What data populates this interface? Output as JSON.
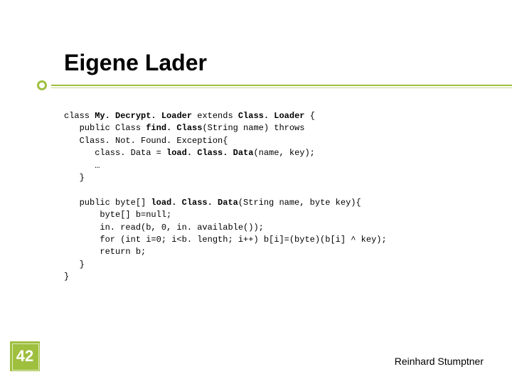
{
  "title": "Eigene Lader",
  "code": {
    "l1a": "class ",
    "l1b": "My. Decrypt. Loader ",
    "l1c": "extends ",
    "l1d": "Class. Loader ",
    "l1e": "{",
    "l2a": "   public Class ",
    "l2b": "find. Class",
    "l2c": "(String name) throws",
    "l3": "   Class. Not. Found. Exception{",
    "l4a": "      class. Data = ",
    "l4b": "load. Class. Data",
    "l4c": "(name, key);",
    "l5": "      …",
    "l6": "   }",
    "blank1": "",
    "l7a": "   public byte[] ",
    "l7b": "load. Class. Data",
    "l7c": "(String name, byte key){",
    "l8": "       byte[] b=null;",
    "l9": "       in. read(b, 0, in. available());",
    "l10": "       for (int i=0; i<b. length; i++) b[i]=(byte)(b[i] ^ key);",
    "l11": "       return b;",
    "l12": "   }",
    "l13": "}"
  },
  "page_number": "42",
  "footer": "Reinhard Stumptner"
}
